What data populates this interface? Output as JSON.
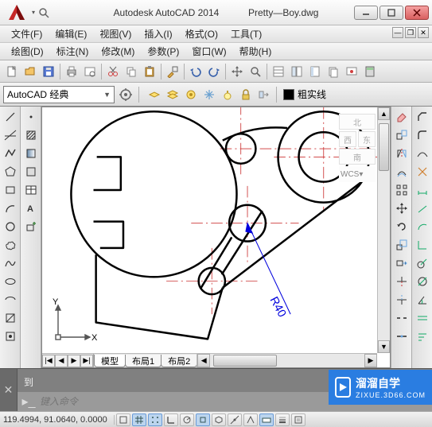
{
  "title": {
    "app": "Autodesk AutoCAD 2014",
    "file": "Pretty—Boy.dwg"
  },
  "menu": {
    "row1": [
      "文件(F)",
      "编辑(E)",
      "视图(V)",
      "插入(I)",
      "格式(O)",
      "工具(T)"
    ],
    "row2": [
      "绘图(D)",
      "标注(N)",
      "修改(M)",
      "参数(P)",
      "窗口(W)",
      "帮助(H)"
    ]
  },
  "workspace": {
    "selected": "AutoCAD 经典"
  },
  "linetype": {
    "label": "粗实线"
  },
  "viewcube": {
    "top": "北",
    "left": "西",
    "right": "东",
    "bottom": "南",
    "wcs": "WCS"
  },
  "layout_tabs": {
    "nav": [
      "|◀",
      "◀",
      "▶",
      "▶|"
    ],
    "tabs": [
      "模型",
      "布局1",
      "布局2"
    ],
    "active": 0
  },
  "dim_label": "R40",
  "ucs": {
    "x": "X",
    "y": "Y"
  },
  "command": {
    "last": "到",
    "placeholder": "键入命令"
  },
  "status": {
    "coords": "119.4994, 91.0640, 0.0000",
    "toggles": [
      "infer",
      "snap",
      "grid",
      "ortho",
      "polar",
      "osnap",
      "3dosnap",
      "otrack",
      "ducs",
      "dyn",
      "lwt",
      "tpy",
      "qp",
      "sc"
    ]
  },
  "watermark": {
    "brand": "溜溜自学",
    "sub": "ZIXUE.3D66.COM"
  }
}
